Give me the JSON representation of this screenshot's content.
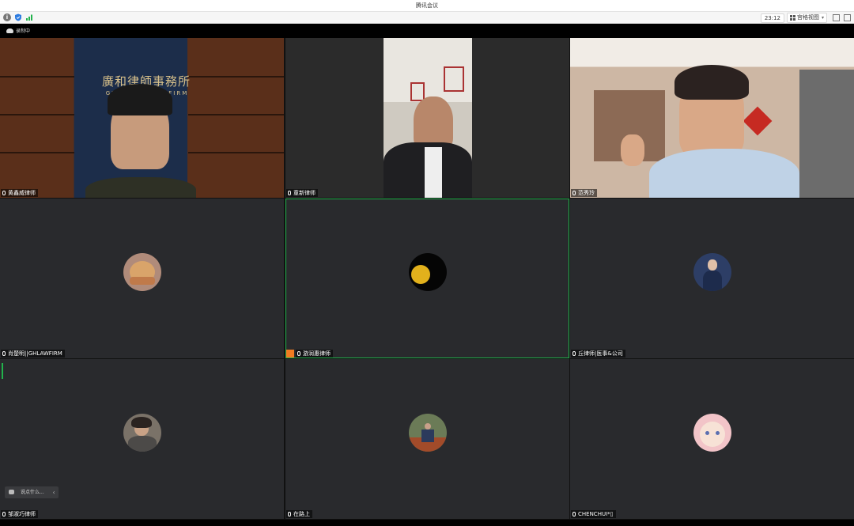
{
  "window": {
    "title": "腾讯会议"
  },
  "toolbar": {
    "info_icon": "info-icon",
    "timer": "23:12",
    "view_label": "宫格视图",
    "view_chevron": "▾"
  },
  "recording": {
    "label": "录制中"
  },
  "chat": {
    "placeholder": "说点什么...",
    "collapse": "‹"
  },
  "participants": [
    {
      "name": "黄鑫威律师",
      "kind": "video-office"
    },
    {
      "name": "童新律师",
      "kind": "video-office2"
    },
    {
      "name": "范秀玲",
      "kind": "video-home"
    },
    {
      "name": "肖楚明||GHLAWFIRM",
      "kind": "avatar"
    },
    {
      "name": "游润惠律师",
      "kind": "avatar",
      "active": true
    },
    {
      "name": "丘律师|医事&公司",
      "kind": "avatar"
    },
    {
      "name": "邹淑巧律师",
      "kind": "avatar"
    },
    {
      "name": "在路上",
      "kind": "avatar"
    },
    {
      "name": "CHENCHUI*▯",
      "kind": "avatar"
    }
  ],
  "banner": {
    "text": "廣和律師事務所",
    "sub": "GUANGHE LAW FIRM"
  },
  "colors": {
    "active_border": "#22b24c",
    "tile_bg": "#292a2d",
    "host_badge": "#f07c21"
  }
}
